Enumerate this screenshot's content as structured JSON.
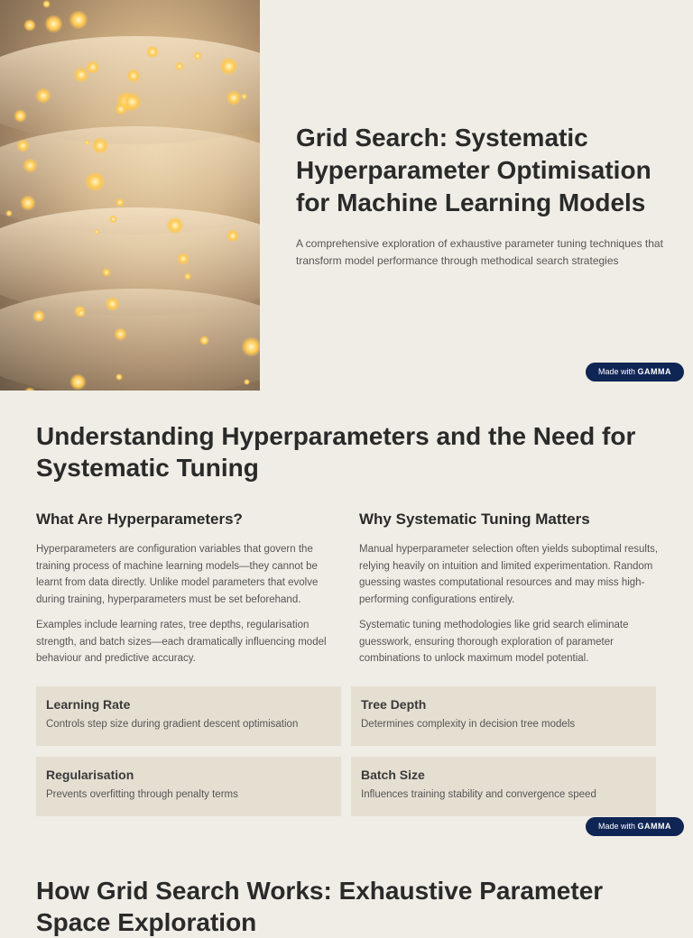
{
  "hero": {
    "title": "Grid Search: Systematic Hyperparameter Optimisation for Machine Learning Models",
    "subtitle": "A comprehensive exploration of exhaustive parameter tuning techniques that transform model performance through methodical search strategies"
  },
  "badge": {
    "prefix": "Made with",
    "brand": "GAMMA"
  },
  "section2": {
    "title": "Understanding Hyperparameters and the Need for Systematic Tuning",
    "left": {
      "heading": "What Are Hyperparameters?",
      "paragraphs": [
        "Hyperparameters are configuration variables that govern the training process of machine learning models—they cannot be learnt from data directly. Unlike model parameters that evolve during training, hyperparameters must be set beforehand.",
        "Examples include learning rates, tree depths, regularisation strength, and batch sizes—each dramatically influencing model behaviour and predictive accuracy."
      ]
    },
    "right": {
      "heading": "Why Systematic Tuning Matters",
      "paragraphs": [
        "Manual hyperparameter selection often yields suboptimal results, relying heavily on intuition and limited experimentation. Random guessing wastes computational resources and may miss high-performing configurations entirely.",
        "Systematic tuning methodologies like grid search eliminate guesswork, ensuring thorough exploration of parameter combinations to unlock maximum model potential."
      ]
    },
    "cards": [
      {
        "title": "Learning Rate",
        "desc": "Controls step size during gradient descent optimisation"
      },
      {
        "title": "Tree Depth",
        "desc": "Determines complexity in decision tree models"
      },
      {
        "title": "Regularisation",
        "desc": "Prevents overfitting through penalty terms"
      },
      {
        "title": "Batch Size",
        "desc": "Influences training stability and convergence speed"
      }
    ]
  },
  "section3": {
    "title": "How Grid Search Works: Exhaustive Parameter Space Exploration"
  }
}
